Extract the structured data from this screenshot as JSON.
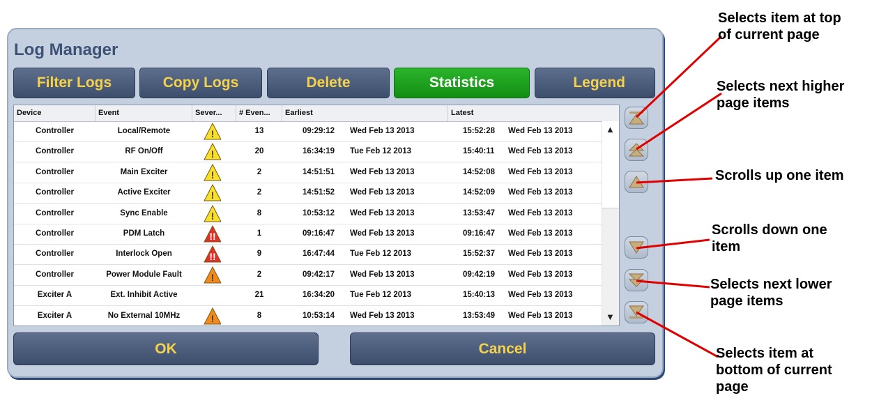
{
  "window": {
    "title": "Log Manager"
  },
  "toolbar": {
    "filter_label": "Filter Logs",
    "copy_label": "Copy Logs",
    "delete_label": "Delete",
    "statistics_label": "Statistics",
    "legend_label": "Legend"
  },
  "table": {
    "columns": [
      "Device",
      "Event",
      "Sever...",
      "# Even...",
      "Earliest",
      "Latest"
    ],
    "rows": [
      {
        "device": "Controller",
        "event": "Local/Remote",
        "severity": "warning-yellow",
        "count": "13",
        "earliest_time": "09:29:12",
        "earliest_date": "Wed Feb 13 2013",
        "latest_time": "15:52:28",
        "latest_date": "Wed Feb 13 2013"
      },
      {
        "device": "Controller",
        "event": "RF On/Off",
        "severity": "warning-yellow",
        "count": "20",
        "earliest_time": "16:34:19",
        "earliest_date": "Tue Feb 12 2013",
        "latest_time": "15:40:11",
        "latest_date": "Wed Feb 13 2013"
      },
      {
        "device": "Controller",
        "event": "Main Exciter",
        "severity": "warning-yellow",
        "count": "2",
        "earliest_time": "14:51:51",
        "earliest_date": "Wed Feb 13 2013",
        "latest_time": "14:52:08",
        "latest_date": "Wed Feb 13 2013"
      },
      {
        "device": "Controller",
        "event": "Active Exciter",
        "severity": "warning-yellow",
        "count": "2",
        "earliest_time": "14:51:52",
        "earliest_date": "Wed Feb 13 2013",
        "latest_time": "14:52:09",
        "latest_date": "Wed Feb 13 2013"
      },
      {
        "device": "Controller",
        "event": "Sync Enable",
        "severity": "warning-yellow",
        "count": "8",
        "earliest_time": "10:53:12",
        "earliest_date": "Wed Feb 13 2013",
        "latest_time": "13:53:47",
        "latest_date": "Wed Feb 13 2013"
      },
      {
        "device": "Controller",
        "event": "PDM Latch",
        "severity": "fault-red",
        "count": "1",
        "earliest_time": "09:16:47",
        "earliest_date": "Wed Feb 13 2013",
        "latest_time": "09:16:47",
        "latest_date": "Wed Feb 13 2013"
      },
      {
        "device": "Controller",
        "event": "Interlock Open",
        "severity": "fault-red",
        "count": "9",
        "earliest_time": "16:47:44",
        "earliest_date": "Tue Feb 12 2013",
        "latest_time": "15:52:37",
        "latest_date": "Wed Feb 13 2013"
      },
      {
        "device": "Controller",
        "event": "Power Module Fault",
        "severity": "warning-orange",
        "count": "2",
        "earliest_time": "09:42:17",
        "earliest_date": "Wed Feb 13 2013",
        "latest_time": "09:42:19",
        "latest_date": "Wed Feb 13 2013"
      },
      {
        "device": "Exciter A",
        "event": "Ext. Inhibit Active",
        "severity": "none",
        "count": "21",
        "earliest_time": "16:34:20",
        "earliest_date": "Tue Feb 12 2013",
        "latest_time": "15:40:13",
        "latest_date": "Wed Feb 13 2013"
      },
      {
        "device": "Exciter A",
        "event": "No External 10MHz",
        "severity": "warning-orange",
        "count": "8",
        "earliest_time": "10:53:14",
        "earliest_date": "Wed Feb 13 2013",
        "latest_time": "13:53:49",
        "latest_date": "Wed Feb 13 2013"
      }
    ]
  },
  "scrollbar": {
    "up_arrow": "▲",
    "down_arrow": "▼"
  },
  "nav_buttons": [
    "top-of-page-icon",
    "page-up-icon",
    "scroll-up-icon",
    "scroll-down-icon",
    "page-down-icon",
    "bottom-of-page-icon"
  ],
  "footer": {
    "ok_label": "OK",
    "cancel_label": "Cancel"
  },
  "annotations": {
    "top_of_page": [
      "Selects item at top",
      "of current page"
    ],
    "next_higher": [
      "Selects next higher",
      "page items"
    ],
    "scroll_up": [
      "Scrolls up one item"
    ],
    "scroll_down": [
      "Scrolls down one",
      "item"
    ],
    "next_lower": [
      "Selects next lower",
      "page items"
    ],
    "bottom_of_page": [
      "Selects item at",
      "bottom of current",
      "page"
    ]
  },
  "colors": {
    "panel": "#c4d0e0",
    "button": "#3d4e6d",
    "button_text": "#f6d24b",
    "active_button": "#1ea01e",
    "warning_yellow": "#f7e02a",
    "warning_orange": "#f08a1c",
    "fault_red": "#e0302a",
    "annotation_line": "#e00000"
  }
}
